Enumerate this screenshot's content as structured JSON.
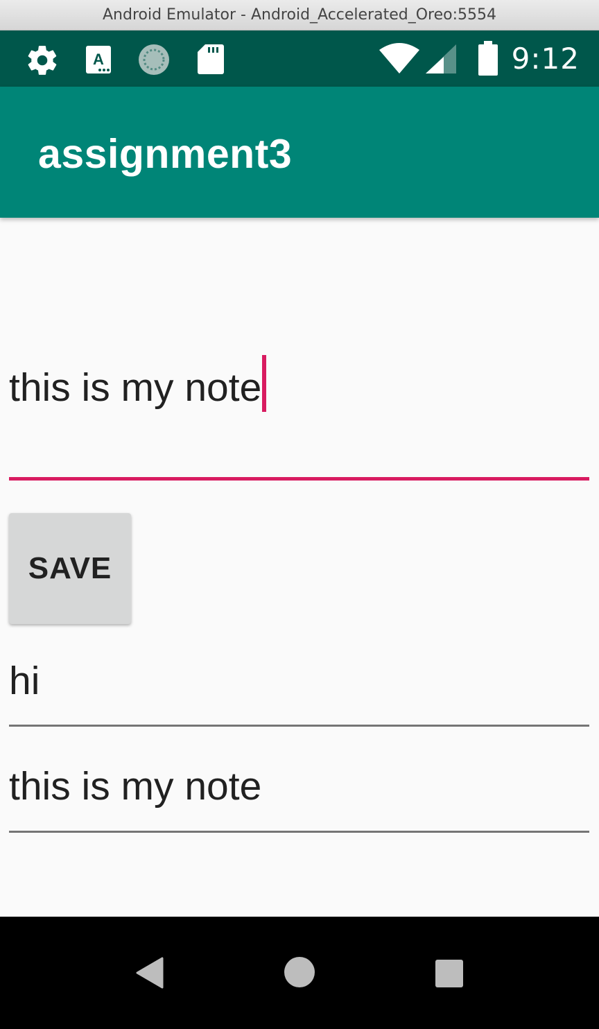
{
  "window": {
    "title": "Android Emulator - Android_Accelerated_Oreo:5554"
  },
  "status_bar": {
    "time": "9:12",
    "icons": [
      "settings-gear-icon",
      "keyboard-a-icon",
      "sync-circle-icon",
      "sd-card-icon",
      "wifi-icon",
      "cell-signal-icon",
      "battery-icon"
    ],
    "background": "#00574b"
  },
  "app_bar": {
    "title": "assignment3",
    "background": "#008577"
  },
  "main": {
    "note_input": {
      "value": "this is my note",
      "accent": "#d81b60"
    },
    "save_button": {
      "label": "SAVE"
    },
    "saved_notes": [
      {
        "text": "hi"
      },
      {
        "text": "this is my note"
      }
    ]
  },
  "nav_bar": {
    "buttons": [
      "back-icon",
      "home-icon",
      "recents-icon"
    ]
  }
}
